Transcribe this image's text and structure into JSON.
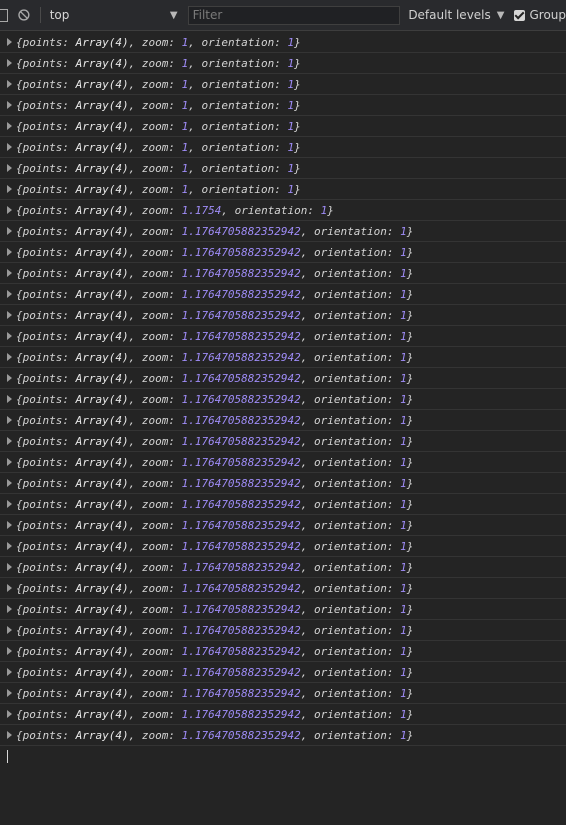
{
  "toolbar": {
    "context": "top",
    "filter_placeholder": "Filter",
    "levels_label": "Default levels",
    "group_label": "Group"
  },
  "logs": [
    {
      "zoom": "1",
      "orientation": "1"
    },
    {
      "zoom": "1",
      "orientation": "1"
    },
    {
      "zoom": "1",
      "orientation": "1"
    },
    {
      "zoom": "1",
      "orientation": "1"
    },
    {
      "zoom": "1",
      "orientation": "1"
    },
    {
      "zoom": "1",
      "orientation": "1"
    },
    {
      "zoom": "1",
      "orientation": "1"
    },
    {
      "zoom": "1",
      "orientation": "1"
    },
    {
      "zoom": "1.1754",
      "orientation": "1"
    },
    {
      "zoom": "1.1764705882352942",
      "orientation": "1"
    },
    {
      "zoom": "1.1764705882352942",
      "orientation": "1"
    },
    {
      "zoom": "1.1764705882352942",
      "orientation": "1"
    },
    {
      "zoom": "1.1764705882352942",
      "orientation": "1"
    },
    {
      "zoom": "1.1764705882352942",
      "orientation": "1"
    },
    {
      "zoom": "1.1764705882352942",
      "orientation": "1"
    },
    {
      "zoom": "1.1764705882352942",
      "orientation": "1"
    },
    {
      "zoom": "1.1764705882352942",
      "orientation": "1"
    },
    {
      "zoom": "1.1764705882352942",
      "orientation": "1"
    },
    {
      "zoom": "1.1764705882352942",
      "orientation": "1"
    },
    {
      "zoom": "1.1764705882352942",
      "orientation": "1"
    },
    {
      "zoom": "1.1764705882352942",
      "orientation": "1"
    },
    {
      "zoom": "1.1764705882352942",
      "orientation": "1"
    },
    {
      "zoom": "1.1764705882352942",
      "orientation": "1"
    },
    {
      "zoom": "1.1764705882352942",
      "orientation": "1"
    },
    {
      "zoom": "1.1764705882352942",
      "orientation": "1"
    },
    {
      "zoom": "1.1764705882352942",
      "orientation": "1"
    },
    {
      "zoom": "1.1764705882352942",
      "orientation": "1"
    },
    {
      "zoom": "1.1764705882352942",
      "orientation": "1"
    },
    {
      "zoom": "1.1764705882352942",
      "orientation": "1"
    },
    {
      "zoom": "1.1764705882352942",
      "orientation": "1"
    },
    {
      "zoom": "1.1764705882352942",
      "orientation": "1"
    },
    {
      "zoom": "1.1764705882352942",
      "orientation": "1"
    },
    {
      "zoom": "1.1764705882352942",
      "orientation": "1"
    },
    {
      "zoom": "1.1764705882352942",
      "orientation": "1"
    }
  ],
  "log_labels": {
    "open": "{",
    "points_key": "points: ",
    "points_val": "Array(4)",
    "zoom_key": ", zoom: ",
    "orientation_key": ", orientation: ",
    "close": "}"
  },
  "colors": {
    "background": "#242424",
    "number": "#9f8cf7"
  }
}
